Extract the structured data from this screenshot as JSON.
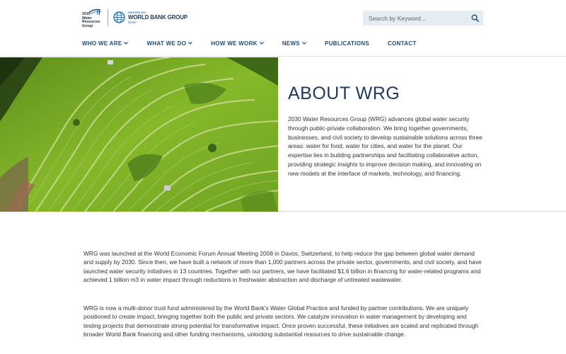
{
  "header": {
    "logo_text": "2030\nWater\nResources\nGroup",
    "partner_hosted": "HOSTED BY",
    "partner_name": "WORLD BANK GROUP",
    "partner_sub": "Water"
  },
  "search": {
    "placeholder": "Search by Keyword..."
  },
  "nav": {
    "items": [
      {
        "label": "WHO WE ARE",
        "dropdown": true
      },
      {
        "label": "WHAT WE DO",
        "dropdown": true
      },
      {
        "label": "HOW WE WORK",
        "dropdown": true
      },
      {
        "label": "NEWS",
        "dropdown": true
      },
      {
        "label": "PUBLICATIONS",
        "dropdown": false
      },
      {
        "label": "CONTACT",
        "dropdown": false
      }
    ]
  },
  "hero": {
    "title": "ABOUT WRG",
    "description": "2030 Water Resources Group (WRG) advances global water security through public-private collaboration. We bring together governments, businesses, and civil society to develop sustainable solutions across three areas: water for food, water for cities, and water for the planet. Our expertise lies in building partnerships and facilitating collaborative action, providing strategic insights to improve decision making, and innovating on new models at the interface of markets, technology, and financing."
  },
  "body": {
    "paragraphs": [
      "WRG was launched at the World Economic Forum Annual Meeting 2008 in Davos, Switzerland, to help reduce the gap between global water demand and supply by 2030. Since then, we have built a network of more than 1,000 partners across the private sector, governments, and civil society, and have launched water security initiatives in 13 countries. Together with our partners, we have facilitated $1.6 billion in financing for water-related programs and achieved 1 billion m3 in water impact through reductions in freshwater abstraction and discharge of untreated wastewater.",
      "WRG is now a multi-donor trust fund administered by the World Bank's Water Global Practice and funded by partner contributions. We are uniquely positioned to create impact, bringing together both the public and private sectors. We catalyze innovation in water management by developing and testing projects that demonstrate strong potential for transformative impact. Once proven successful, these initiatives are scaled and replicated through broader World Bank financing and other funding mechanisms, unlocking substantial resources to drive sustainable change."
    ]
  },
  "colors": {
    "brand_navy": "#1f3a5c",
    "nav_blue": "#1f4e79",
    "search_bg": "#e6edf2",
    "rice_green": "#7fb52a"
  }
}
